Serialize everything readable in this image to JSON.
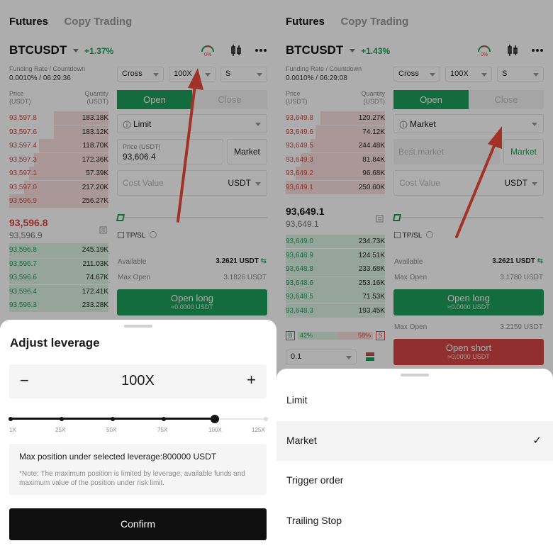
{
  "nav": {
    "futures": "Futures",
    "copy_trading": "Copy Trading"
  },
  "left": {
    "symbol": "BTCUSDT",
    "change": "+1.37%",
    "funding_label": "Funding Rate / Countdown",
    "funding_rate": "0.0010% /",
    "countdown": "06:29:36",
    "gauge_label": "0%",
    "margin_mode": "Cross",
    "leverage": "100X",
    "size_unit": "S",
    "tab_open": "Open",
    "tab_close": "Close",
    "order_type": "Limit",
    "price_label": "Price (USDT)",
    "price_value": "93,606.4",
    "market_btn": "Market",
    "cost_placeholder": "Cost Value",
    "cost_unit": "USDT",
    "tpsl": "TP/SL",
    "available_label": "Available",
    "available_value": "3.2621 USDT",
    "max_open_label": "Max Open",
    "max_open_value": "3.1826 USDT",
    "open_long": "Open long",
    "open_long_sub": "≈0.0000 USDT",
    "ob_price_header": "Price",
    "ob_price_unit": "(USDT)",
    "ob_qty_header": "Quantity",
    "ob_qty_unit": "(USDT)",
    "asks": [
      {
        "p": "93,597.8",
        "q": "183.18K",
        "d": 0.55
      },
      {
        "p": "93,597.6",
        "q": "183.12K",
        "d": 0.55
      },
      {
        "p": "93,597.4",
        "q": "118.70K",
        "d": 0.7
      },
      {
        "p": "93,597.3",
        "q": "172.36K",
        "d": 0.75
      },
      {
        "p": "93,597.1",
        "q": "57.39K",
        "d": 0.8
      },
      {
        "p": "93,597.0",
        "q": "217.20K",
        "d": 0.85
      },
      {
        "p": "93,596.9",
        "q": "256.27K",
        "d": 1.0
      }
    ],
    "last_price": "93,596.8",
    "mark_price": "93,596.9",
    "bids": [
      {
        "p": "93,596.8",
        "q": "245.19K",
        "d": 1.0
      },
      {
        "p": "93,596.7",
        "q": "211.03K",
        "d": 1.0
      },
      {
        "p": "93,596.6",
        "q": "74.67K",
        "d": 1.0
      },
      {
        "p": "93,596.4",
        "q": "172.41K",
        "d": 1.0
      },
      {
        "p": "93,596.3",
        "q": "233.28K",
        "d": 1.0
      }
    ],
    "sheet": {
      "title": "Adjust leverage",
      "minus": "−",
      "value": "100X",
      "plus": "+",
      "slider_fraction": 0.8,
      "ticks": [
        "1X",
        "25X",
        "50X",
        "75X",
        "100X",
        "125X"
      ],
      "max_position": "Max position under selected leverage:800000 USDT",
      "note": "*Note: The maximum position is limited by leverage, available funds and maximum value of the position under risk limit.",
      "confirm": "Confirm"
    }
  },
  "right": {
    "symbol": "BTCUSDT",
    "change": "+1.43%",
    "funding_label": "Funding Rate / Countdown",
    "funding_rate": "0.0010% /",
    "countdown": "06:29:08",
    "gauge_label": "0%",
    "margin_mode": "Cross",
    "leverage": "100X",
    "size_unit": "S",
    "tab_open": "Open",
    "tab_close": "Close",
    "order_type": "Market",
    "best_market": "Best market",
    "market_btn": "Market",
    "cost_placeholder": "Cost Value",
    "cost_unit": "USDT",
    "tpsl": "TP/SL",
    "available_label": "Available",
    "available_value": "3.2621 USDT",
    "max_open_label": "Max Open",
    "max_open_value": "3.1780 USDT",
    "open_long": "Open long",
    "open_long_sub": "≈0.0000 USDT",
    "max_open2_label": "Max Open",
    "max_open2_value": "3.2159 USDT",
    "open_short": "Open short",
    "open_short_sub": "≈0.0000 USDT",
    "ob_price_header": "Price",
    "ob_price_unit": "(USDT)",
    "ob_qty_header": "Quantity",
    "ob_qty_unit": "(USDT)",
    "asks": [
      {
        "p": "93,649.8",
        "q": "120.27K",
        "d": 0.65
      },
      {
        "p": "93,649.6",
        "q": "74.12K",
        "d": 0.7
      },
      {
        "p": "93,649.5",
        "q": "244.48K",
        "d": 0.75
      },
      {
        "p": "93,649.3",
        "q": "81.84K",
        "d": 0.85
      },
      {
        "p": "93,649.2",
        "q": "96.68K",
        "d": 0.9
      },
      {
        "p": "93,649.1",
        "q": "250.60K",
        "d": 1.0
      }
    ],
    "last_price": "93,649.1",
    "mark_price": "93,649.1",
    "bids": [
      {
        "p": "93,649.0",
        "q": "234.73K",
        "d": 1.0
      },
      {
        "p": "93,648.9",
        "q": "124.51K",
        "d": 1.0
      },
      {
        "p": "93,648.8",
        "q": "233.68K",
        "d": 1.0
      },
      {
        "p": "93,648.6",
        "q": "253.16K",
        "d": 1.0
      },
      {
        "p": "93,648.5",
        "q": "71.53K",
        "d": 1.0
      },
      {
        "p": "93,648.3",
        "q": "193.45K",
        "d": 1.0
      }
    ],
    "ratio": {
      "b": "B",
      "bp": "42%",
      "sp": "58%",
      "s": "S"
    },
    "depth_select": "0.1",
    "sheet": {
      "options": [
        "Limit",
        "Market",
        "Trigger order",
        "Trailing Stop"
      ],
      "selected": "Market",
      "check": "✓"
    }
  },
  "colors": {
    "green": "#1e9e5a",
    "red": "#d64545",
    "arrow": "#ef4b3c"
  }
}
